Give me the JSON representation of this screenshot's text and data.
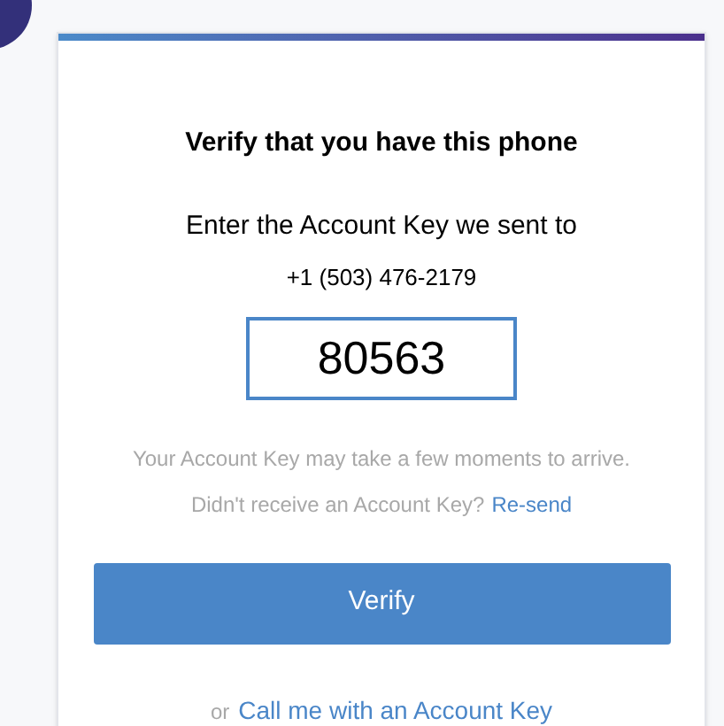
{
  "title": "Verify that you have this phone",
  "instruction": "Enter the Account Key we sent to",
  "phone": "+1 (503) 476-2179",
  "code_field": {
    "value": "80563",
    "focused": true
  },
  "hint": "Your Account Key may take a few moments to arrive.",
  "resend": {
    "text": "Didn't receive an Account Key?",
    "link": "Re-send"
  },
  "verify_button": "Verify",
  "alternative": {
    "prefix": "or",
    "link": "Call me with an Account Key"
  }
}
